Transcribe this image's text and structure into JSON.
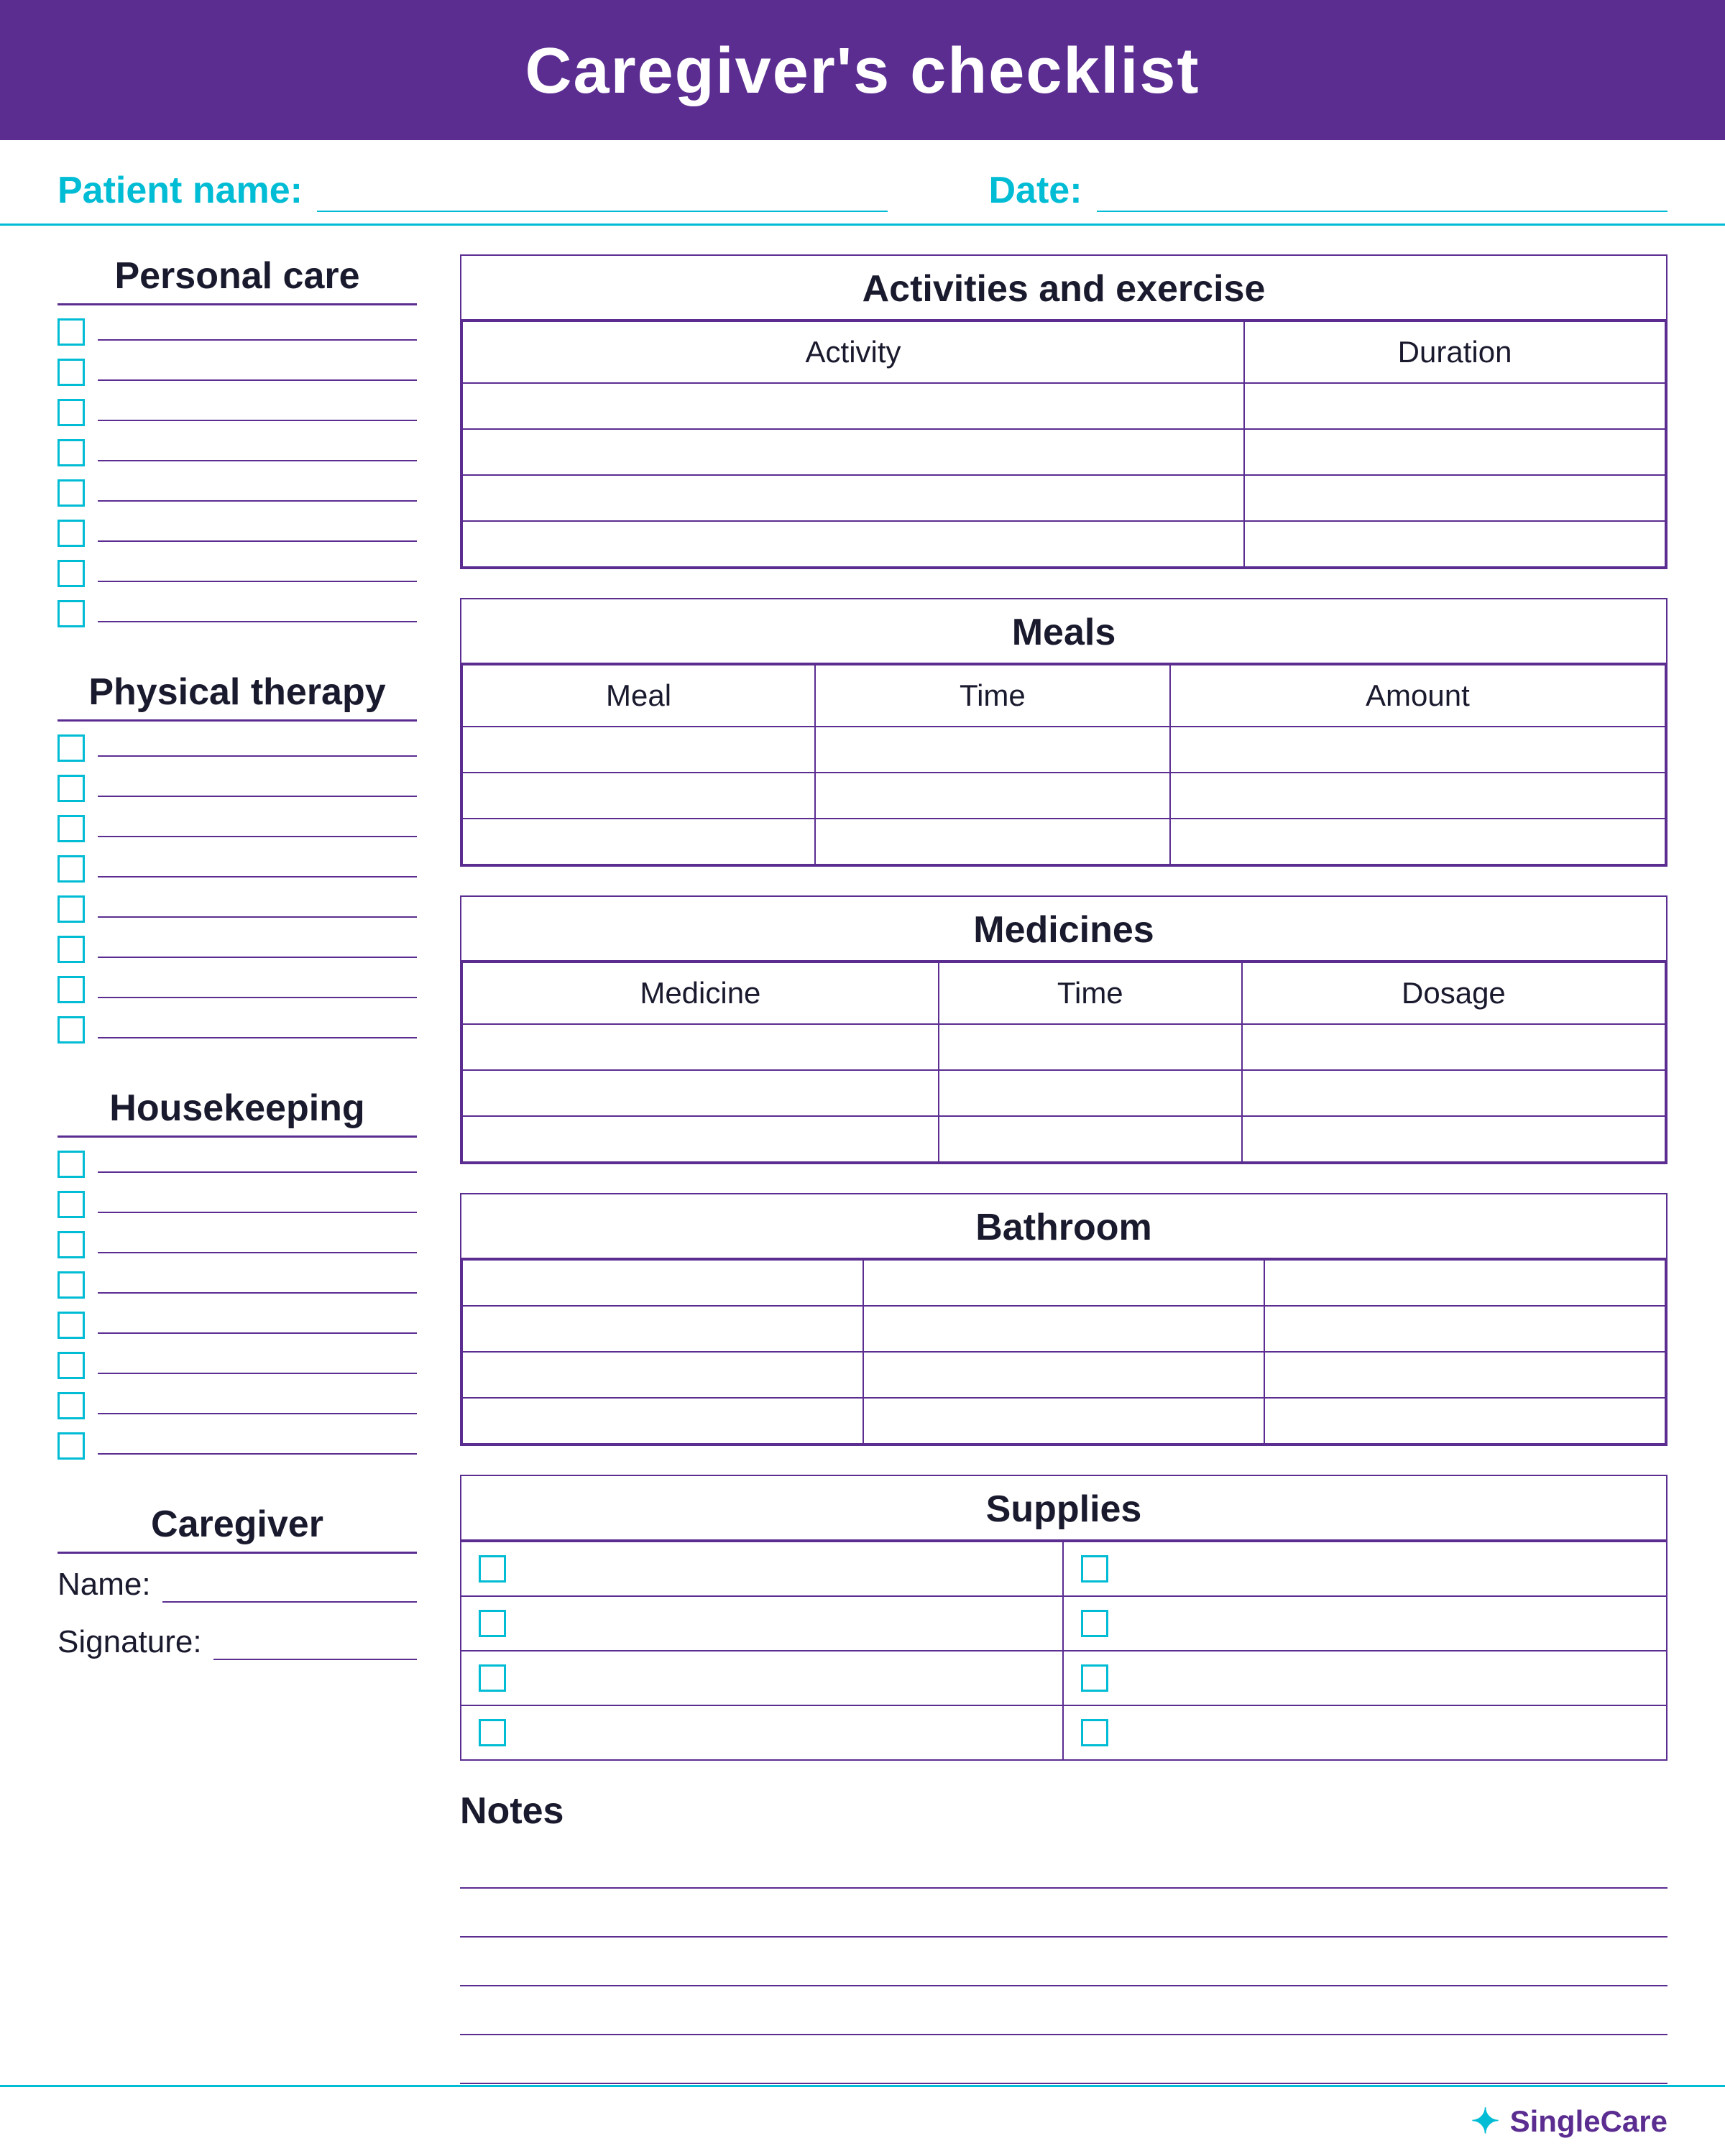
{
  "header": {
    "title": "Caregiver's checklist"
  },
  "patient_row": {
    "name_label": "Patient name:",
    "date_label": "Date:"
  },
  "left": {
    "personal_care": {
      "title": "Personal care",
      "items": 8
    },
    "physical_therapy": {
      "title": "Physical therapy",
      "items": 8
    },
    "housekeeping": {
      "title": "Housekeeping",
      "items": 8
    },
    "caregiver": {
      "title": "Caregiver",
      "name_label": "Name:",
      "signature_label": "Signature:"
    }
  },
  "right": {
    "activities": {
      "title": "Activities and exercise",
      "col1": "Activity",
      "col2": "Duration",
      "rows": 4
    },
    "meals": {
      "title": "Meals",
      "col1": "Meal",
      "col2": "Time",
      "col3": "Amount",
      "rows": 3
    },
    "medicines": {
      "title": "Medicines",
      "col1": "Medicine",
      "col2": "Time",
      "col3": "Dosage",
      "rows": 3
    },
    "bathroom": {
      "title": "Bathroom",
      "rows": 4
    },
    "supplies": {
      "title": "Supplies",
      "items": 8
    },
    "notes": {
      "label": "Notes",
      "lines": 5
    }
  },
  "footer": {
    "logo_icon": "✦",
    "logo_text": "SingleCare"
  }
}
